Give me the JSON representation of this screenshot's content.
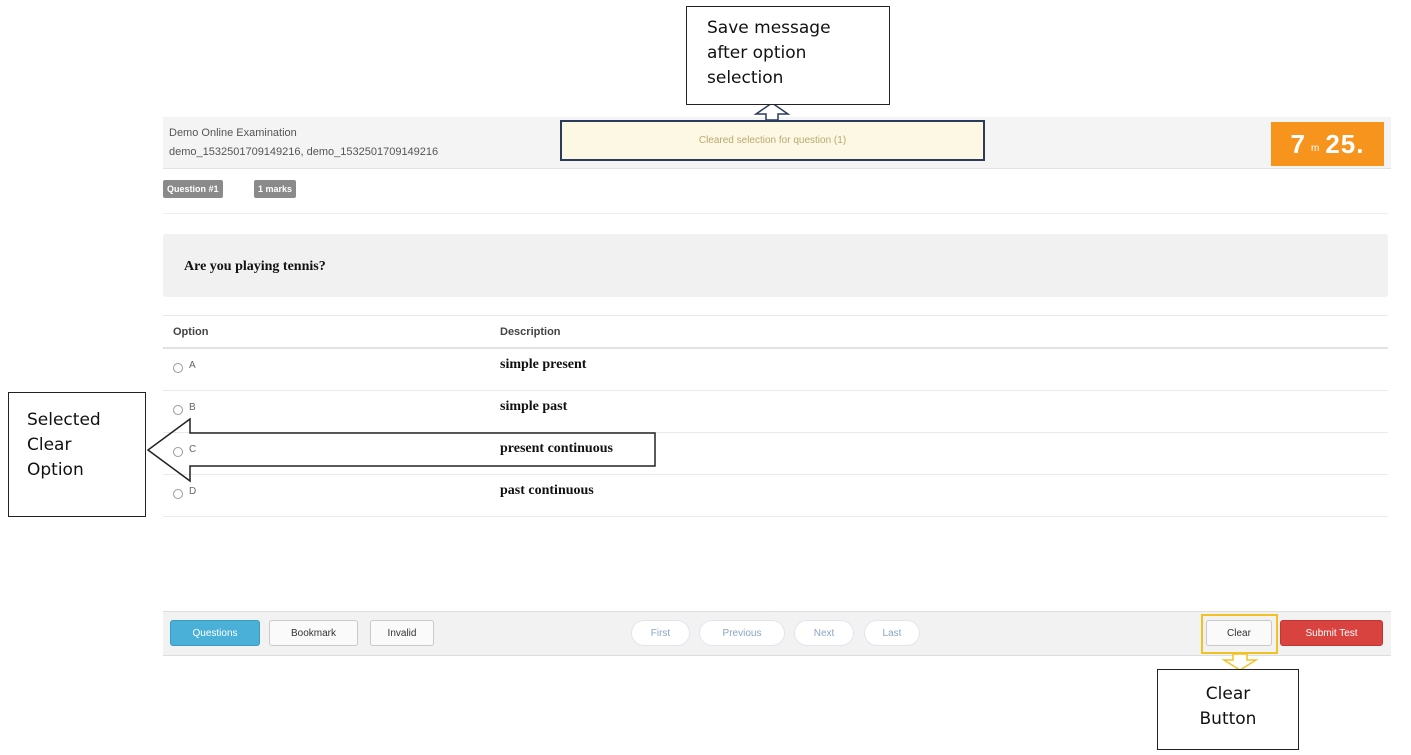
{
  "header": {
    "exam_name": "Demo Online Examination",
    "exam_ids": "demo_1532501709149216, demo_1532501709149216",
    "status_message": "Cleared selection for question (1)",
    "timer": {
      "minutes": "7",
      "separator": "m",
      "seconds": "25."
    }
  },
  "badges": {
    "question": "Question #1",
    "marks": "1 marks"
  },
  "question": {
    "text": "Are you playing tennis?"
  },
  "options_table": {
    "headers": [
      "Option",
      "Description"
    ],
    "rows": [
      {
        "letter": "A",
        "description": "simple present",
        "selected": false
      },
      {
        "letter": "B",
        "description": "simple past",
        "selected": false
      },
      {
        "letter": "C",
        "description": "present continuous",
        "selected": false
      },
      {
        "letter": "D",
        "description": "past continuous",
        "selected": false
      }
    ]
  },
  "footer": {
    "questions": "Questions",
    "bookmark": "Bookmark",
    "invalid": "Invalid",
    "first": "First",
    "previous": "Previous",
    "next": "Next",
    "last": "Last",
    "clear": "Clear",
    "submit": "Submit Test"
  },
  "annotations": {
    "save_message": [
      "Save message",
      "after option",
      "selection"
    ],
    "selected_clear": [
      "Selected",
      "Clear",
      "Option"
    ],
    "clear_button": [
      "Clear",
      "Button"
    ]
  },
  "colors": {
    "timer": "#f7941e",
    "primary": "#4ab0d8",
    "danger": "#d9433f",
    "toast_bg": "#fcf8e3",
    "highlight": "#f2c224"
  }
}
